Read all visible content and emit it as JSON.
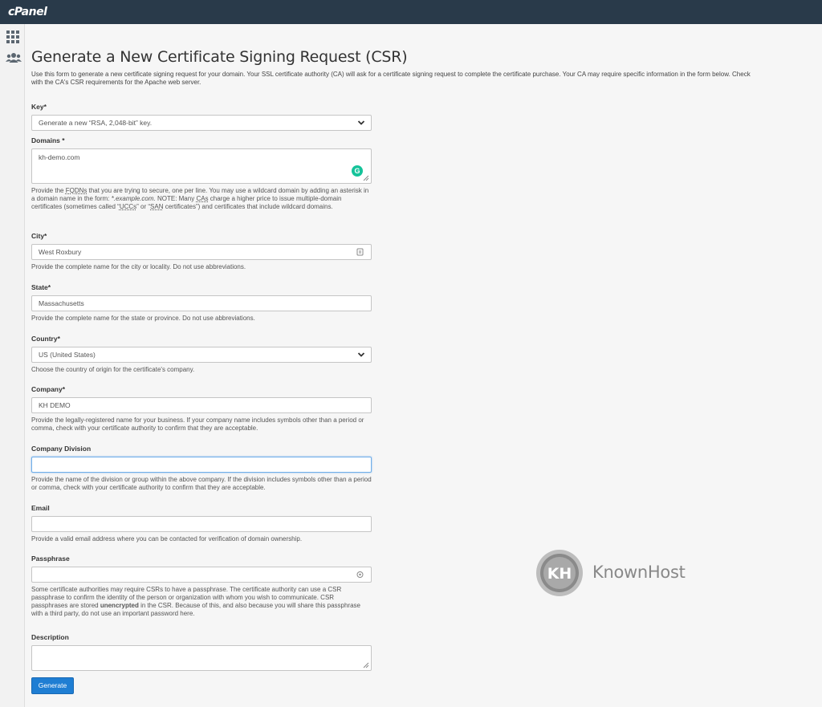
{
  "app": {
    "logo": "cPanel"
  },
  "page": {
    "title": "Generate a New Certificate Signing Request (CSR)",
    "intro": "Use this form to generate a new certificate signing request for your domain. Your SSL certificate authority (CA) will ask for a certificate signing request to complete the certificate purchase. Your CA may require specific information in the form below. Check with the CA's CSR requirements for the Apache web server."
  },
  "form": {
    "key": {
      "label": "Key*",
      "value": "Generate a new “RSA, 2,048-bit” key."
    },
    "domains": {
      "label": "Domains *",
      "value": "kh-demo.com",
      "help_1": "Provide the ",
      "help_fqdns": "FQDNs",
      "help_2": " that you are trying to secure, one per line. You may use a wildcard domain by adding an asterisk in a domain name in the form: ",
      "help_example": "*.example.com",
      "help_3": ". NOTE: Many ",
      "help_cas": "CAs",
      "help_4": " charge a higher price to issue multiple-domain certificates (sometimes called “",
      "help_uccs": "UCCs",
      "help_5": "” or “",
      "help_san": "SAN",
      "help_6": " certificates”) and certificates that include wildcard domains."
    },
    "city": {
      "label": "City*",
      "value": "West Roxbury",
      "help": "Provide the complete name for the city or locality. Do not use abbreviations."
    },
    "state": {
      "label": "State*",
      "value": "Massachusetts",
      "help": "Provide the complete name for the state or province. Do not use abbreviations."
    },
    "country": {
      "label": "Country*",
      "value": "US (United States)",
      "help": "Choose the country of origin for the certificate's company."
    },
    "company": {
      "label": "Company*",
      "value": "KH DEMO",
      "help": "Provide the legally-registered name for your business. If your company name includes symbols other than a period or comma, check with your certificate authority to confirm that they are acceptable."
    },
    "division": {
      "label": "Company Division",
      "value": "",
      "help": "Provide the name of the division or group within the above company. If the division includes symbols other than a period or comma, check with your certificate authority to confirm that they are acceptable."
    },
    "email": {
      "label": "Email",
      "value": "",
      "help": "Provide a valid email address where you can be contacted for verification of domain ownership."
    },
    "passphrase": {
      "label": "Passphrase",
      "value": "",
      "help_1": "Some certificate authorities may require CSRs to have a passphrase. The certificate authority can use a CSR passphrase to confirm the identity of the person or organization with whom you wish to communicate. CSR passphrases are stored ",
      "help_bold": "unencrypted",
      "help_2": " in the CSR. Because of this, and also because you will share this passphrase with a third party, do not use an important password here."
    },
    "description": {
      "label": "Description",
      "value": ""
    },
    "submit_label": "Generate"
  },
  "watermark": {
    "brand": "KnownHost",
    "mark": "KH"
  },
  "colors": {
    "topbar": "#293a4a",
    "primary_button": "#1f7ed3",
    "grammarly": "#15c39a"
  }
}
